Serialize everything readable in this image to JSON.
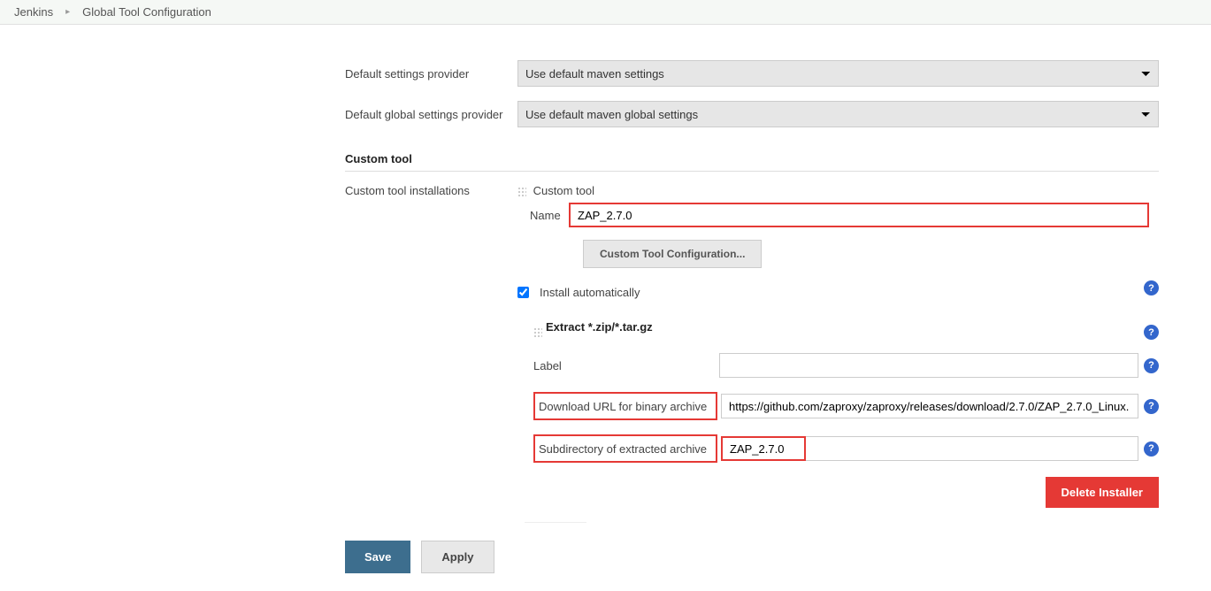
{
  "breadcrumb": {
    "home": "Jenkins",
    "page": "Global Tool Configuration"
  },
  "settings": {
    "default_label": "Default settings provider",
    "default_value": "Use default maven settings",
    "global_label": "Default global settings provider",
    "global_value": "Use default maven global settings"
  },
  "custom_tool": {
    "section_title": "Custom tool",
    "installations_label": "Custom tool installations",
    "tool_title": "Custom tool",
    "name_label": "Name",
    "name_value": "ZAP_2.7.0",
    "config_button": "Custom Tool Configuration...",
    "install_auto_label": "Install automatically",
    "extract": {
      "title": "Extract *.zip/*.tar.gz",
      "label_label": "Label",
      "label_value": "",
      "url_label": "Download URL for binary archive",
      "url_value": "https://github.com/zaproxy/zaproxy/releases/download/2.7.0/ZAP_2.7.0_Linux.",
      "subdir_label": "Subdirectory of extracted archive",
      "subdir_value": "ZAP_2.7.0"
    },
    "delete_button": "Delete Installer"
  },
  "footer": {
    "save": "Save",
    "apply": "Apply"
  },
  "help_glyph": "?"
}
